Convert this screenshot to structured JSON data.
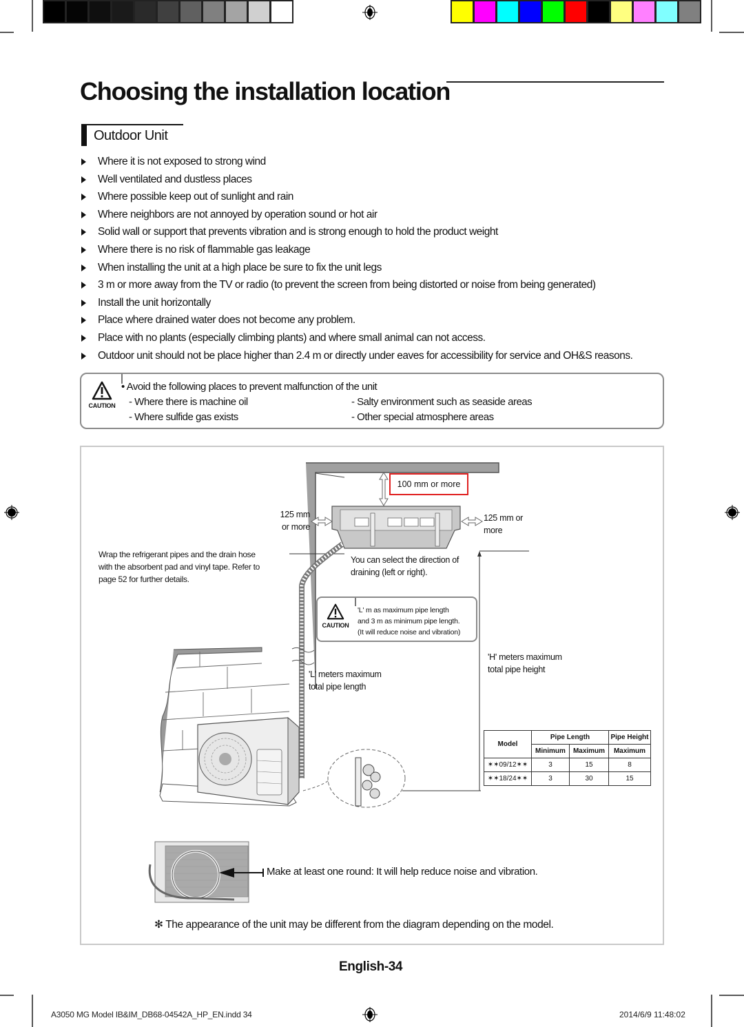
{
  "print_marks": {
    "grayscale_swatches": [
      "#000000",
      "#050505",
      "#0f0f0f",
      "#1a1a1a",
      "#2a2a2a",
      "#404040",
      "#606060",
      "#808080",
      "#a4a4a4",
      "#d0d0d0",
      "#ffffff"
    ],
    "color_swatches": [
      "#ffff00",
      "#ff00ff",
      "#00ffff",
      "#0000ff",
      "#00ff00",
      "#ff0000",
      "#000000",
      "#ffff80",
      "#ff80ff",
      "#80ffff",
      "#808080"
    ]
  },
  "page": {
    "title": "Choosing the installation location",
    "section_heading": "Outdoor Unit",
    "page_number": "English-34"
  },
  "bullets": [
    "Where it is not exposed to strong wind",
    "Well ventilated and dustless places",
    "Where possible keep out of sunlight and rain",
    "Where neighbors are not annoyed by operation sound or hot air",
    "Solid wall or support that prevents vibration and is strong enough to hold the product weight",
    "Where there is no risk of flammable gas leakage",
    "When installing the unit at a high place be sure to fix the unit legs",
    "3 m or more away from the TV or radio (to prevent the screen from being distorted or noise from being generated)",
    "Install the unit horizontally",
    "Place where drained water does not become any problem.",
    "Place with no plants (especially climbing plants) and where small animal can not access.",
    "Outdoor unit should not be place higher than 2.4 m or directly under eaves for accessibility for service and OH&S reasons."
  ],
  "caution": {
    "label": "CAUTION",
    "intro": "• Avoid the following places to prevent malfunction of the unit",
    "items": [
      "- Where there is machine oil",
      "- Salty environment such as seaside areas",
      "- Where sulfide gas exists",
      "- Other special atmosphere areas"
    ]
  },
  "diagram": {
    "clearance_top": "100 mm or more",
    "clearance_left": [
      "125 mm",
      "or more"
    ],
    "clearance_right": [
      "125 mm or",
      "more"
    ],
    "wrap_note": [
      "Wrap the refrigerant pipes and the drain hose",
      "with the absorbent pad and vinyl tape. Refer to",
      "page 52 for further details."
    ],
    "drain_note": [
      "You can select the direction of",
      "draining (left or right)."
    ],
    "mini_caution": {
      "label": "CAUTION",
      "lines": [
        "'L' m as maximum pipe length",
        "and 3 m as minimum pipe length.",
        "(It will reduce noise and vibration)"
      ]
    },
    "length_note": [
      "'L' meters maximum",
      "total pipe length"
    ],
    "height_note": [
      "'H' meters maximum",
      "total pipe height"
    ],
    "round_note": "Make at least one round: It will help reduce noise and vibration.",
    "appearance_note": "✻ The appearance of the unit may be different from the diagram depending on the model."
  },
  "spec_table": {
    "headers": {
      "model": "Model",
      "pipe_length": "Pipe Length",
      "pipe_height": "Pipe Height",
      "minimum": "Minimum",
      "maximum": "Maximum",
      "maximum_h": "Maximum"
    },
    "rows": [
      {
        "model": "✶✶09/12✶✶",
        "min": "3",
        "max": "15",
        "height": "8"
      },
      {
        "model": "✶✶18/24✶✶",
        "min": "3",
        "max": "30",
        "height": "15"
      }
    ]
  },
  "footer": {
    "file": "A3050 MG Model IB&IM_DB68-04542A_HP_EN.indd   34",
    "timestamp": "2014/6/9   11:48:02"
  }
}
